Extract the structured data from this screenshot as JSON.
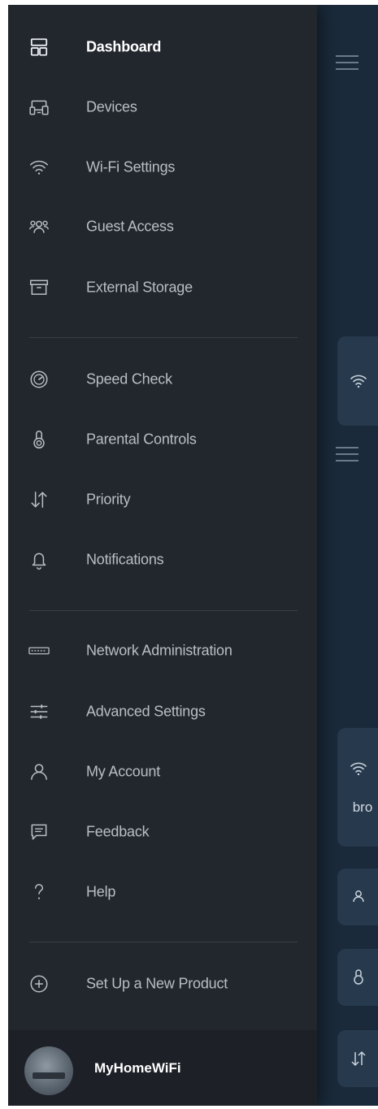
{
  "menu": {
    "items": [
      {
        "label": "Dashboard",
        "icon": "dashboard-icon"
      },
      {
        "label": "Devices",
        "icon": "devices-icon"
      },
      {
        "label": "Wi-Fi Settings",
        "icon": "wifi-icon"
      },
      {
        "label": "Guest Access",
        "icon": "guest-icon"
      },
      {
        "label": "External Storage",
        "icon": "storage-icon"
      },
      {
        "label": "Speed Check",
        "icon": "speedometer-icon"
      },
      {
        "label": "Parental Controls",
        "icon": "parental-icon"
      },
      {
        "label": "Priority",
        "icon": "priority-arrows-icon"
      },
      {
        "label": "Notifications",
        "icon": "bell-icon"
      },
      {
        "label": "Network Administration",
        "icon": "router-icon"
      },
      {
        "label": "Advanced Settings",
        "icon": "sliders-icon"
      },
      {
        "label": "My Account",
        "icon": "user-icon"
      },
      {
        "label": "Feedback",
        "icon": "feedback-icon"
      },
      {
        "label": "Help",
        "icon": "help-icon"
      },
      {
        "label": "Set Up a New Product",
        "icon": "add-circle-icon"
      }
    ]
  },
  "footer": {
    "network_name": "MyHomeWiFi"
  },
  "background": {
    "card_text": "bro"
  },
  "colors": {
    "drawer": "#22262d",
    "background": "#1a2a3a",
    "active_text": "#ffffff",
    "inactive_text": "#b9bec6"
  }
}
